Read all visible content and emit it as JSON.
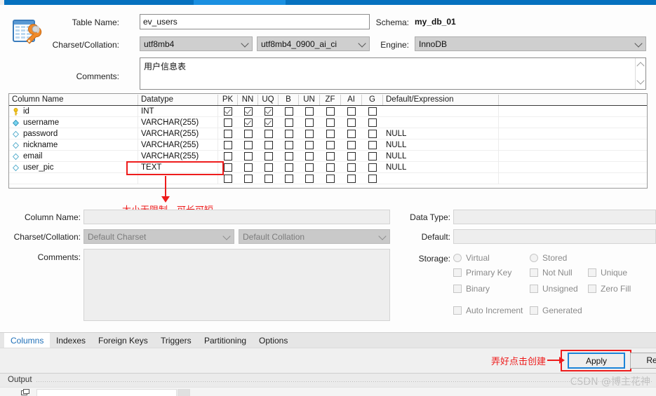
{
  "window": {
    "tabstrip_accent": "#0671bf",
    "active_tab_accent": "#1a8fe0"
  },
  "header": {
    "icon": "table-editor-icon",
    "table_name_label": "Table Name:",
    "table_name_value": "ev_users",
    "charset_collation_label": "Charset/Collation:",
    "charset_value": "utf8mb4",
    "collation_value": "utf8mb4_0900_ai_ci",
    "comments_label": "Comments:",
    "comments_value": "用户信息表",
    "schema_label": "Schema:",
    "schema_value": "my_db_01",
    "engine_label": "Engine:",
    "engine_value": "InnoDB"
  },
  "grid": {
    "headers": {
      "column_name": "Column Name",
      "datatype": "Datatype",
      "pk": "PK",
      "nn": "NN",
      "uq": "UQ",
      "b": "B",
      "un": "UN",
      "zf": "ZF",
      "ai": "AI",
      "g": "G",
      "default_expression": "Default/Expression"
    },
    "rows": [
      {
        "icon": "primary-key-icon",
        "name": "id",
        "datatype": "INT",
        "pk": true,
        "nn": true,
        "uq": true,
        "b": false,
        "un": false,
        "zf": false,
        "ai": false,
        "g": false,
        "default": ""
      },
      {
        "icon": "indexed-column-icon",
        "name": "username",
        "datatype": "VARCHAR(255)",
        "pk": false,
        "nn": true,
        "uq": true,
        "b": false,
        "un": false,
        "zf": false,
        "ai": false,
        "g": false,
        "default": ""
      },
      {
        "icon": "column-icon",
        "name": "password",
        "datatype": "VARCHAR(255)",
        "pk": false,
        "nn": false,
        "uq": false,
        "b": false,
        "un": false,
        "zf": false,
        "ai": false,
        "g": false,
        "default": "NULL"
      },
      {
        "icon": "column-icon",
        "name": "nickname",
        "datatype": "VARCHAR(255)",
        "pk": false,
        "nn": false,
        "uq": false,
        "b": false,
        "un": false,
        "zf": false,
        "ai": false,
        "g": false,
        "default": "NULL"
      },
      {
        "icon": "column-icon",
        "name": "email",
        "datatype": "VARCHAR(255)",
        "pk": false,
        "nn": false,
        "uq": false,
        "b": false,
        "un": false,
        "zf": false,
        "ai": false,
        "g": false,
        "default": "NULL"
      },
      {
        "icon": "column-icon",
        "name": "user_pic",
        "datatype": "TEXT",
        "pk": false,
        "nn": false,
        "uq": false,
        "b": false,
        "un": false,
        "zf": false,
        "ai": false,
        "g": false,
        "default": "NULL"
      },
      {
        "icon": "",
        "name": "",
        "datatype": "",
        "pk": false,
        "nn": false,
        "uq": false,
        "b": false,
        "un": false,
        "zf": false,
        "ai": false,
        "g": false,
        "default": ""
      }
    ]
  },
  "annotations": {
    "color": "#ee1c1c",
    "datatype_note": "大小无限制，可长可短",
    "apply_note": "弄好点击创建"
  },
  "detail_left": {
    "column_name_label": "Column Name:",
    "column_name_value": "",
    "charset_collation_label": "Charset/Collation:",
    "charset_placeholder": "Default Charset",
    "collation_placeholder": "Default Collation",
    "comments_label": "Comments:",
    "comments_value": ""
  },
  "detail_right": {
    "data_type_label": "Data Type:",
    "data_type_value": "",
    "default_label": "Default:",
    "default_value": "",
    "storage_label": "Storage:",
    "storage_options": [
      {
        "type": "radio",
        "label": "Virtual",
        "checked": false
      },
      {
        "type": "radio",
        "label": "Stored",
        "checked": false
      },
      {
        "type": "check",
        "label": "Primary Key",
        "checked": false
      },
      {
        "type": "check",
        "label": "Not Null",
        "checked": false
      },
      {
        "type": "check",
        "label": "Unique",
        "checked": false
      },
      {
        "type": "check",
        "label": "Binary",
        "checked": false
      },
      {
        "type": "check",
        "label": "Unsigned",
        "checked": false
      },
      {
        "type": "check",
        "label": "Zero Fill",
        "checked": false
      },
      {
        "type": "check",
        "label": "Auto Increment",
        "checked": false
      },
      {
        "type": "check",
        "label": "Generated",
        "checked": false
      }
    ]
  },
  "bottom_tabs": [
    {
      "label": "Columns",
      "active": true
    },
    {
      "label": "Indexes",
      "active": false
    },
    {
      "label": "Foreign Keys",
      "active": false
    },
    {
      "label": "Triggers",
      "active": false
    },
    {
      "label": "Partitioning",
      "active": false
    },
    {
      "label": "Options",
      "active": false
    }
  ],
  "actions": {
    "apply_label": "Apply",
    "revert_label": "Revert"
  },
  "output": {
    "label": "Output",
    "watermark": "CSDN @博主花神"
  }
}
